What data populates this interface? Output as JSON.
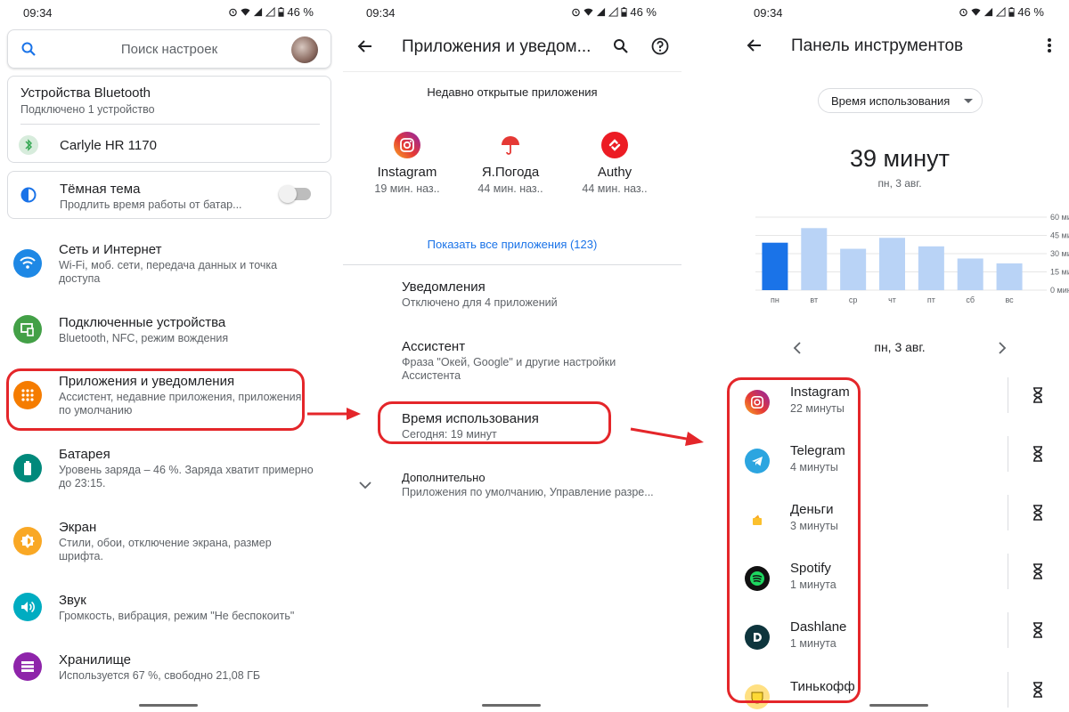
{
  "status": {
    "time": "09:34",
    "battery": "46 %"
  },
  "panel1": {
    "search_placeholder": "Поиск настроек",
    "bluetooth": {
      "title": "Устройства Bluetooth",
      "subtitle": "Подключено 1 устройство",
      "device": "Carlyle HR 1170"
    },
    "dark_theme": {
      "title": "Тёмная тема",
      "subtitle": "Продлить время работы от батар..."
    },
    "items": [
      {
        "title": "Сеть и Интернет",
        "line1": "Wi-Fi, моб. сети, передача данных и точка",
        "line2": "доступа",
        "color": "#1e88e5",
        "icon": "wifi-icon"
      },
      {
        "title": "Подключенные устройства",
        "line1": "Bluetooth, NFC, режим вождения",
        "line2": "",
        "color": "#43a047",
        "icon": "devices-icon"
      },
      {
        "title": "Приложения и уведомления",
        "line1": "Ассистент, недавние приложения, приложения",
        "line2": "по умолчанию",
        "color": "#f57c00",
        "icon": "apps-icon"
      },
      {
        "title": "Батарея",
        "line1": "Уровень заряда – 46 %. Заряда хватит примерно",
        "line2": "до 23:15.",
        "color": "#00897b",
        "icon": "battery-icon"
      },
      {
        "title": "Экран",
        "line1": "Стили, обои, отключение экрана, размер",
        "line2": "шрифта.",
        "color": "#f9a825",
        "icon": "brightness-icon"
      },
      {
        "title": "Звук",
        "line1": "Громкость, вибрация, режим \"Не беспокоить\"",
        "line2": "",
        "color": "#00acc1",
        "icon": "volume-icon"
      },
      {
        "title": "Хранилище",
        "line1": "Используется 67 %, свободно 21,08 ГБ",
        "line2": "",
        "color": "#8e24aa",
        "icon": "storage-icon"
      }
    ]
  },
  "panel2": {
    "title": "Приложения и уведом...",
    "recent_title": "Недавно открытые приложения",
    "recent": [
      {
        "name": "Instagram",
        "time": "19 мин. наз..",
        "icon": "instagram-icon"
      },
      {
        "name": "Я.Погода",
        "time": "44 мин. наз..",
        "icon": "umbrella-icon"
      },
      {
        "name": "Authy",
        "time": "44 мин. наз..",
        "icon": "authy-icon"
      }
    ],
    "show_all": "Показать все приложения (123)",
    "items": [
      {
        "title": "Уведомления",
        "line1": "Отключено для 4 приложений",
        "line2": ""
      },
      {
        "title": "Ассистент",
        "line1": "Фраза \"Окей, Google\" и другие настройки",
        "line2": "Ассистента"
      },
      {
        "title": "Время использования",
        "line1": "Сегодня: 19 минут",
        "line2": ""
      },
      {
        "title": "Дополнительно",
        "line1": "Приложения по умолчанию, Управление разре...",
        "line2": ""
      }
    ]
  },
  "panel3": {
    "title": "Панель инструментов",
    "dropdown": "Время использования",
    "total": "39 минут",
    "date": "пн, 3 авг.",
    "day_nav": "пн, 3 авг.",
    "apps": [
      {
        "name": "Instagram",
        "time": "22 минуты",
        "icon": "instagram-icon"
      },
      {
        "name": "Telegram",
        "time": "4 минуты",
        "icon": "telegram-icon"
      },
      {
        "name": "Деньги",
        "time": "3 минуты",
        "icon": "wallet-icon"
      },
      {
        "name": "Spotify",
        "time": "1 минута",
        "icon": "spotify-icon"
      },
      {
        "name": "Dashlane",
        "time": "1 минута",
        "icon": "dashlane-icon"
      },
      {
        "name": "Тинькофф",
        "time": "",
        "icon": "tinkoff-icon"
      }
    ]
  },
  "chart_data": {
    "type": "bar",
    "categories": [
      "пн",
      "вт",
      "ср",
      "чт",
      "пт",
      "сб",
      "вс"
    ],
    "values": [
      39,
      51,
      34,
      43,
      36,
      26,
      22
    ],
    "selected_index": 0,
    "ylim": [
      0,
      60
    ],
    "yticks": [
      "0 мин",
      "15 мин",
      "30 мин",
      "45 мин",
      "60 мин"
    ],
    "ytick_values": [
      0,
      15,
      30,
      45,
      60
    ],
    "grid": true,
    "colors": {
      "selected": "#1a73e8",
      "other": "#b9d3f6"
    }
  },
  "annotation_color": "#e4262a"
}
